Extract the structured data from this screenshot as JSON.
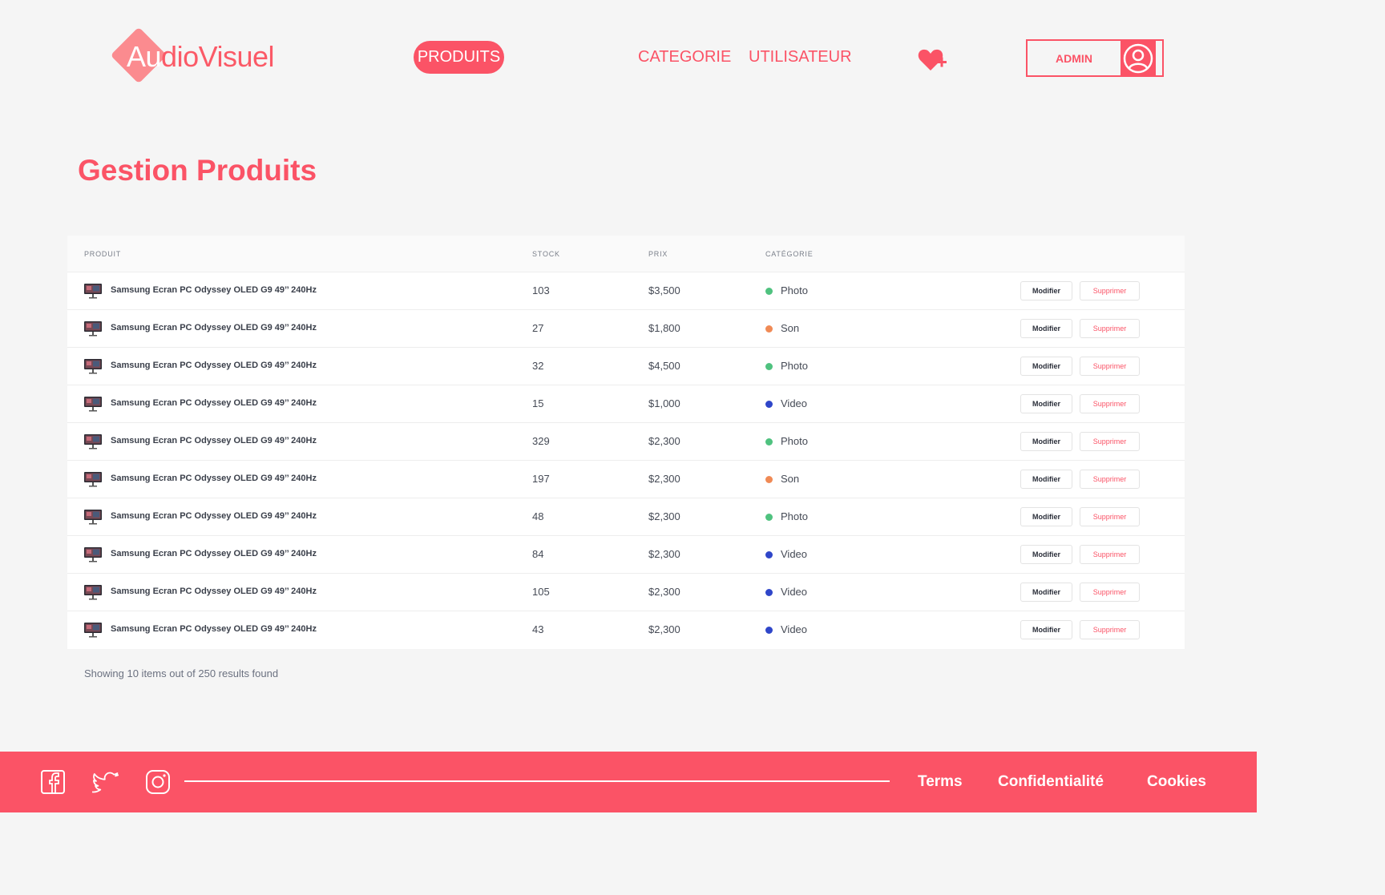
{
  "header": {
    "logo_prefix": "Au",
    "logo_suffix": "dioVisuel",
    "nav": {
      "produits": "PRODUITS",
      "categorie": "CATEGORIE",
      "utilisateur": "UTILISATEUR"
    },
    "favorites_icon": "heart-plus-icon",
    "admin_label": "ADMIN",
    "avatar_icon": "user-circle-icon"
  },
  "page": {
    "title": "Gestion Produits"
  },
  "table": {
    "columns": {
      "produit": "PRODUIT",
      "stock": "STOCK",
      "prix": "PRIX",
      "categorie": "CATÉGORIE"
    },
    "edit_label": "Modifier",
    "delete_label": "Supprimer",
    "rows": [
      {
        "name": "Samsung Ecran PC Odyssey OLED G9 49’’ 240Hz",
        "stock": "103",
        "price": "$3,500",
        "category": "Photo",
        "color": "#4fc27f"
      },
      {
        "name": "Samsung Ecran PC Odyssey OLED G9 49’’ 240Hz",
        "stock": "27",
        "price": "$1,800",
        "category": "Son",
        "color": "#f08a55"
      },
      {
        "name": "Samsung Ecran PC Odyssey OLED G9 49’’ 240Hz",
        "stock": "32",
        "price": "$4,500",
        "category": "Photo",
        "color": "#4fc27f"
      },
      {
        "name": "Samsung Ecran PC Odyssey OLED G9 49’’ 240Hz",
        "stock": "15",
        "price": "$1,000",
        "category": "Video",
        "color": "#2f46c9"
      },
      {
        "name": "Samsung Ecran PC Odyssey OLED G9 49’’ 240Hz",
        "stock": "329",
        "price": "$2,300",
        "category": "Photo",
        "color": "#4fc27f"
      },
      {
        "name": "Samsung Ecran PC Odyssey OLED G9 49’’ 240Hz",
        "stock": "197",
        "price": "$2,300",
        "category": "Son",
        "color": "#f08a55"
      },
      {
        "name": "Samsung Ecran PC Odyssey OLED G9 49’’ 240Hz",
        "stock": "48",
        "price": "$2,300",
        "category": "Photo",
        "color": "#4fc27f"
      },
      {
        "name": "Samsung Ecran PC Odyssey OLED G9 49’’ 240Hz",
        "stock": "84",
        "price": "$2,300",
        "category": "Video",
        "color": "#2f46c9"
      },
      {
        "name": "Samsung Ecran PC Odyssey OLED G9 49’’ 240Hz",
        "stock": "105",
        "price": "$2,300",
        "category": "Video",
        "color": "#2f46c9"
      },
      {
        "name": "Samsung Ecran PC Odyssey OLED G9 49’’ 240Hz",
        "stock": "43",
        "price": "$2,300",
        "category": "Video",
        "color": "#2f46c9"
      }
    ],
    "result_summary": "Showing 10 items out of 250 results found"
  },
  "footer": {
    "social_icons": [
      "facebook-icon",
      "twitter-icon",
      "instagram-icon"
    ],
    "links": {
      "terms": "Terms",
      "confidentialite": "Confidentialité",
      "cookies": "Cookies"
    }
  },
  "colors": {
    "brand": "#fb5366",
    "background": "#f5f5f5"
  }
}
